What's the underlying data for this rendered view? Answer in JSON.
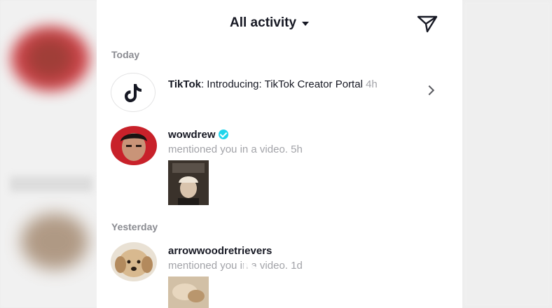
{
  "header": {
    "title": "All activity",
    "filter_icon": "chevron-down-icon",
    "send_icon": "send-icon"
  },
  "sections": {
    "today": "Today",
    "yesterday": "Yesterday"
  },
  "notifications": [
    {
      "name": "TikTok",
      "message": ": Introducing: TikTok Creator Portal",
      "time": "4h",
      "icon": "tiktok-logo-icon"
    },
    {
      "name": "wowdrew",
      "verified": true,
      "message": "mentioned you in a video.",
      "time": "5h"
    },
    {
      "name": "arrowwoodretrievers",
      "message": "mentioned you in a video.",
      "time": "1d"
    }
  ],
  "colors": {
    "text_primary": "#161823",
    "text_secondary": "#a2a3a8",
    "verified": "#20d5ec"
  }
}
